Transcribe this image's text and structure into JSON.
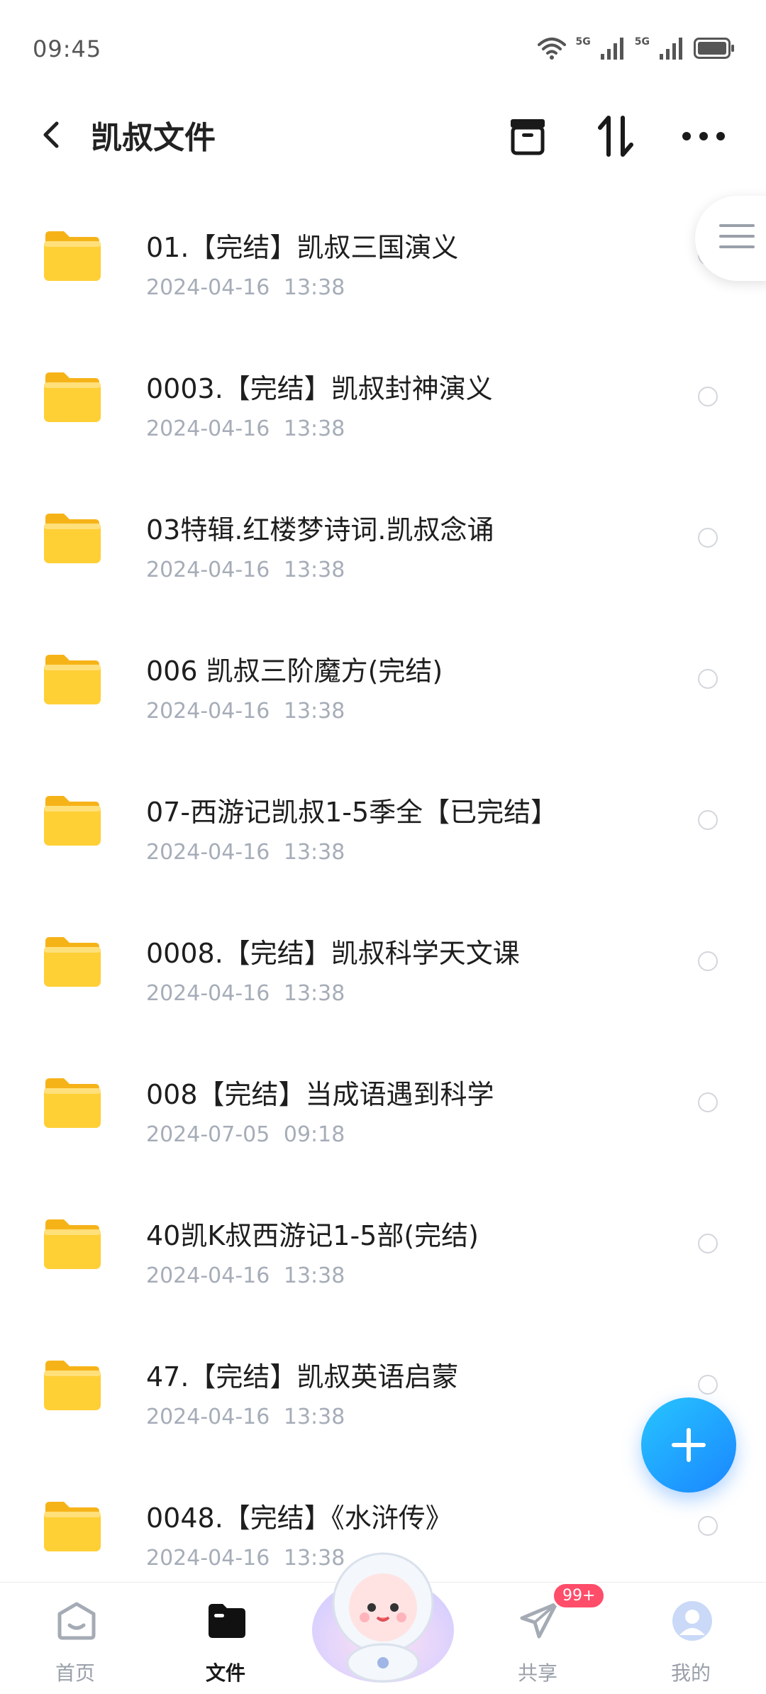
{
  "status_bar": {
    "time": "09:45",
    "network_1": "5G",
    "network_2": "5G"
  },
  "header": {
    "title": "凯叔文件"
  },
  "files": [
    {
      "name": "01.【完结】凯叔三国演义",
      "date": "2024-04-16  13:38"
    },
    {
      "name": "0003.【完结】凯叔封神演义",
      "date": "2024-04-16  13:38"
    },
    {
      "name": "03特辑.红楼梦诗词.凯叔念诵",
      "date": "2024-04-16  13:38"
    },
    {
      "name": "006 凯叔三阶魔方(完结)",
      "date": "2024-04-16  13:38"
    },
    {
      "name": "07-西游记凯叔1-5季全【已完结】",
      "date": "2024-04-16  13:38"
    },
    {
      "name": "0008.【完结】凯叔科学天文课",
      "date": "2024-04-16  13:38"
    },
    {
      "name": "008【完结】当成语遇到科学",
      "date": "2024-07-05  09:18"
    },
    {
      "name": "40凯K叔西游记1-5部(完结)",
      "date": "2024-04-16  13:38"
    },
    {
      "name": "47.【完结】凯叔英语启蒙",
      "date": "2024-04-16  13:38"
    },
    {
      "name": "0048.【完结】《水浒传》",
      "date": "2024-04-16  13:38"
    }
  ],
  "bottom_nav": {
    "home": "首页",
    "files": "文件",
    "share": "共享",
    "mine": "我的",
    "share_badge": "99+"
  },
  "colors": {
    "accent": "#1a86ff",
    "folder": "#ffc92b",
    "badge": "#ff4d6a"
  }
}
